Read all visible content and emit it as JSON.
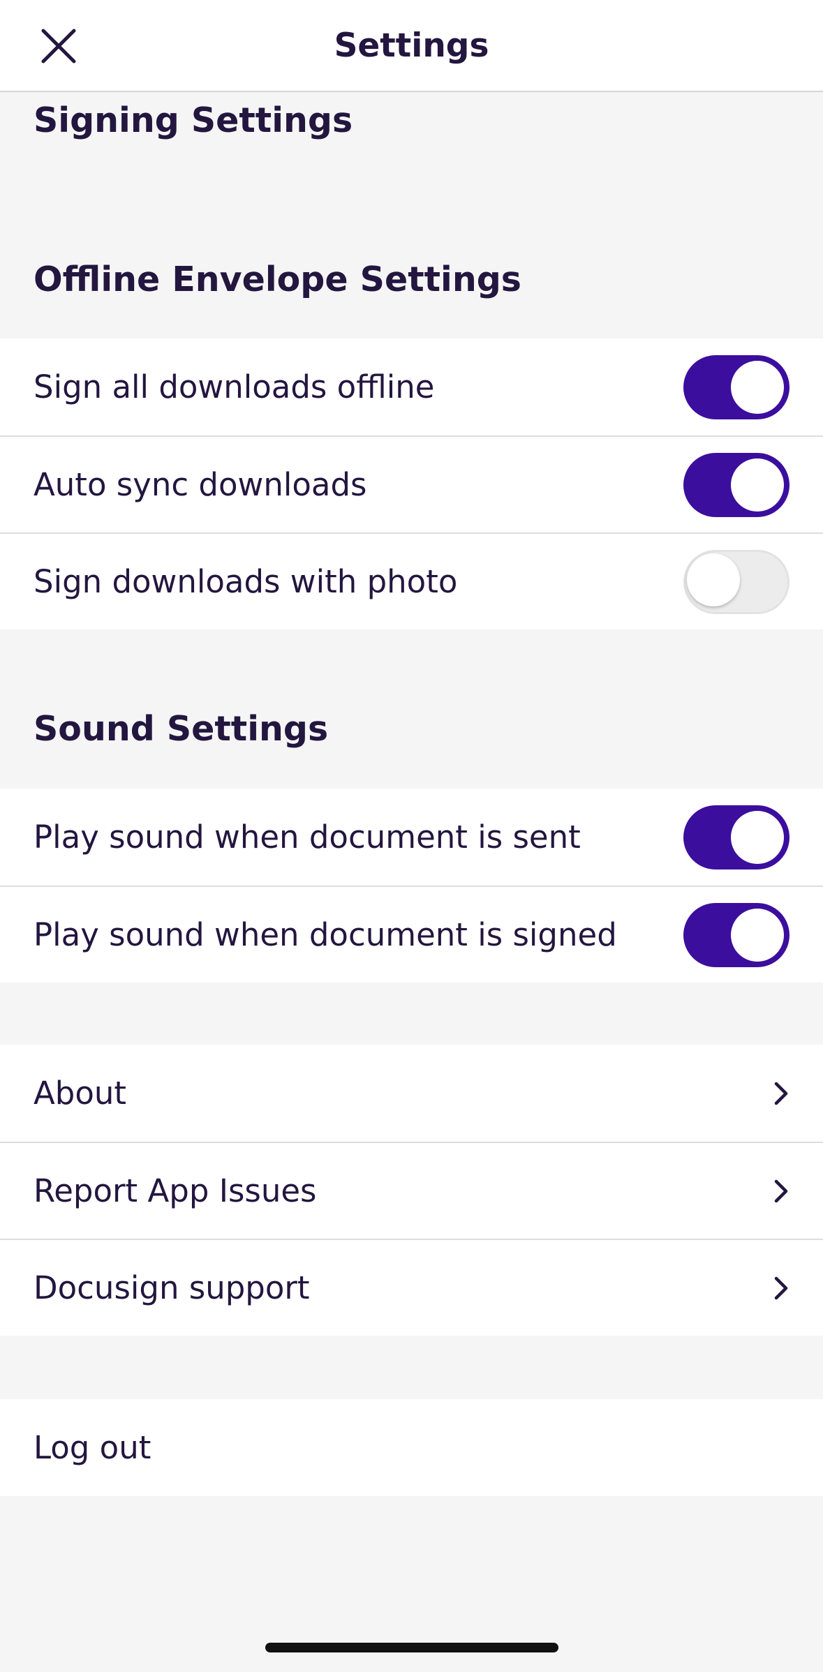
{
  "header": {
    "title": "Settings",
    "close_icon": "close-icon"
  },
  "sections": {
    "signing_header": "Signing Settings",
    "offline_header": "Offline Envelope Settings",
    "sound_header": "Sound Settings"
  },
  "offline_settings": [
    {
      "label": "Sign all downloads offline",
      "enabled": true
    },
    {
      "label": "Auto sync downloads",
      "enabled": true
    },
    {
      "label": "Sign downloads with photo",
      "enabled": false
    }
  ],
  "sound_settings": [
    {
      "label": "Play sound when document is sent",
      "enabled": true
    },
    {
      "label": "Play sound when document is signed",
      "enabled": true
    }
  ],
  "links": [
    {
      "label": "About",
      "icon": "chevron-right-icon"
    },
    {
      "label": "Report App Issues",
      "icon": "chevron-right-icon"
    },
    {
      "label": "Docusign support",
      "icon": "chevron-right-icon"
    }
  ],
  "logout": {
    "label": "Log out"
  },
  "colors": {
    "accent": "#3b0e9e",
    "text": "#23163f",
    "background": "#f5f5f5"
  }
}
